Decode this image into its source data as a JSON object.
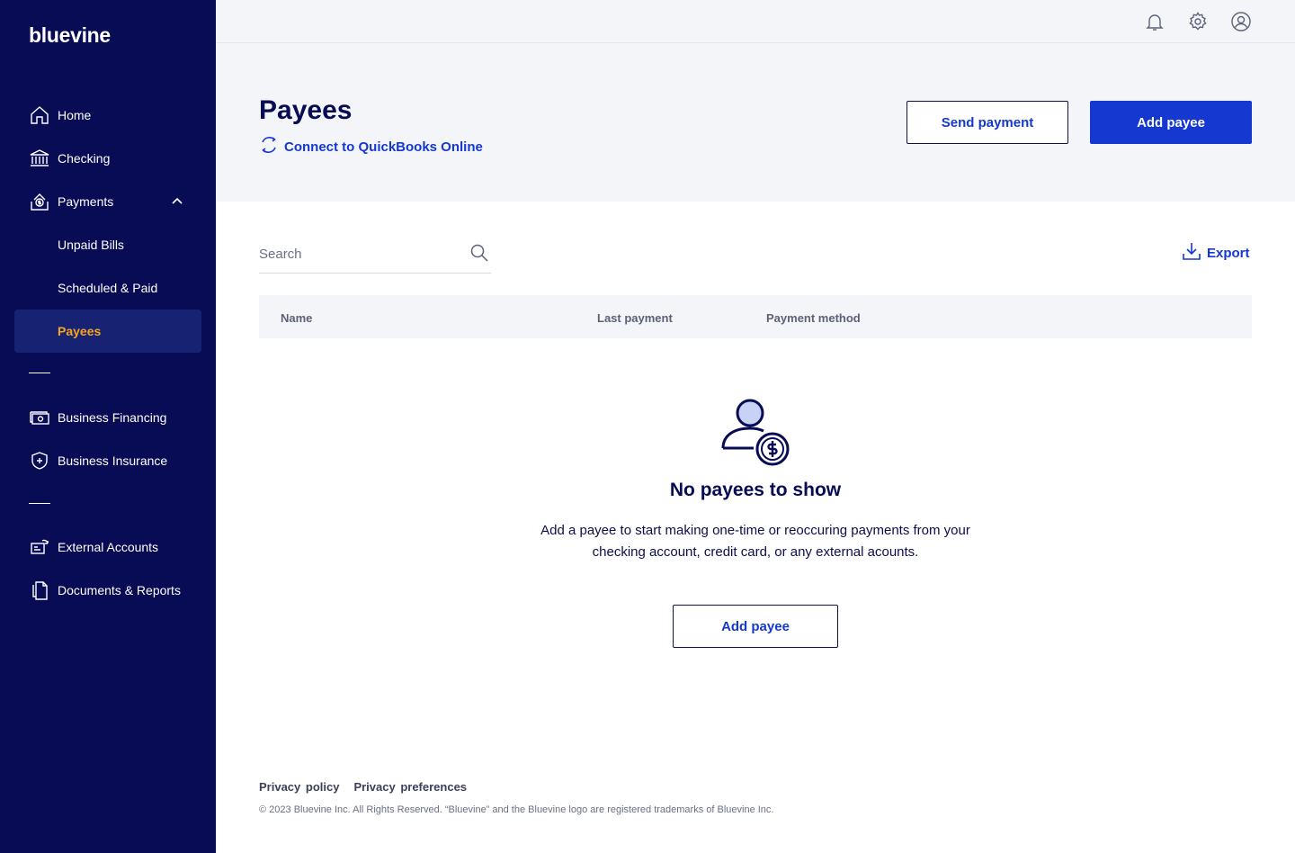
{
  "brand": {
    "logo": "bluevine"
  },
  "sidebar": {
    "items": [
      {
        "label": "Home"
      },
      {
        "label": "Checking"
      },
      {
        "label": "Payments"
      },
      {
        "label": "Unpaid Bills"
      },
      {
        "label": "Scheduled & Paid"
      },
      {
        "label": "Payees"
      },
      {
        "label": "Business Financing"
      },
      {
        "label": "Business Insurance"
      },
      {
        "label": "External Accounts"
      },
      {
        "label": "Documents & Reports"
      }
    ]
  },
  "header": {
    "title": "Payees",
    "quickbooks_link": "Connect to QuickBooks Online",
    "send_payment_label": "Send payment",
    "add_payee_label": "Add payee"
  },
  "search": {
    "placeholder": "Search"
  },
  "export_label": "Export",
  "table": {
    "columns": [
      "Name",
      "Last payment",
      "Payment method"
    ]
  },
  "empty_state": {
    "title": "No payees to show",
    "description": "Add a payee to start making one-time or reoccuring payments from your checking account, credit card, or any external acounts.",
    "button_label": "Add payee"
  },
  "footer": {
    "privacy_policy": "Privacy policy",
    "privacy_preferences": "Privacy preferences",
    "copyright": "© 2023 Bluevine Inc. All Rights Reserved. “Bluevine” and the Bluevine logo are registered trademarks of Bluevine Inc."
  },
  "colors": {
    "sidebar_bg": "#080c55",
    "accent_blue": "#1538d0",
    "active_label": "#f5a623",
    "header_bg": "#f4f5f9"
  }
}
